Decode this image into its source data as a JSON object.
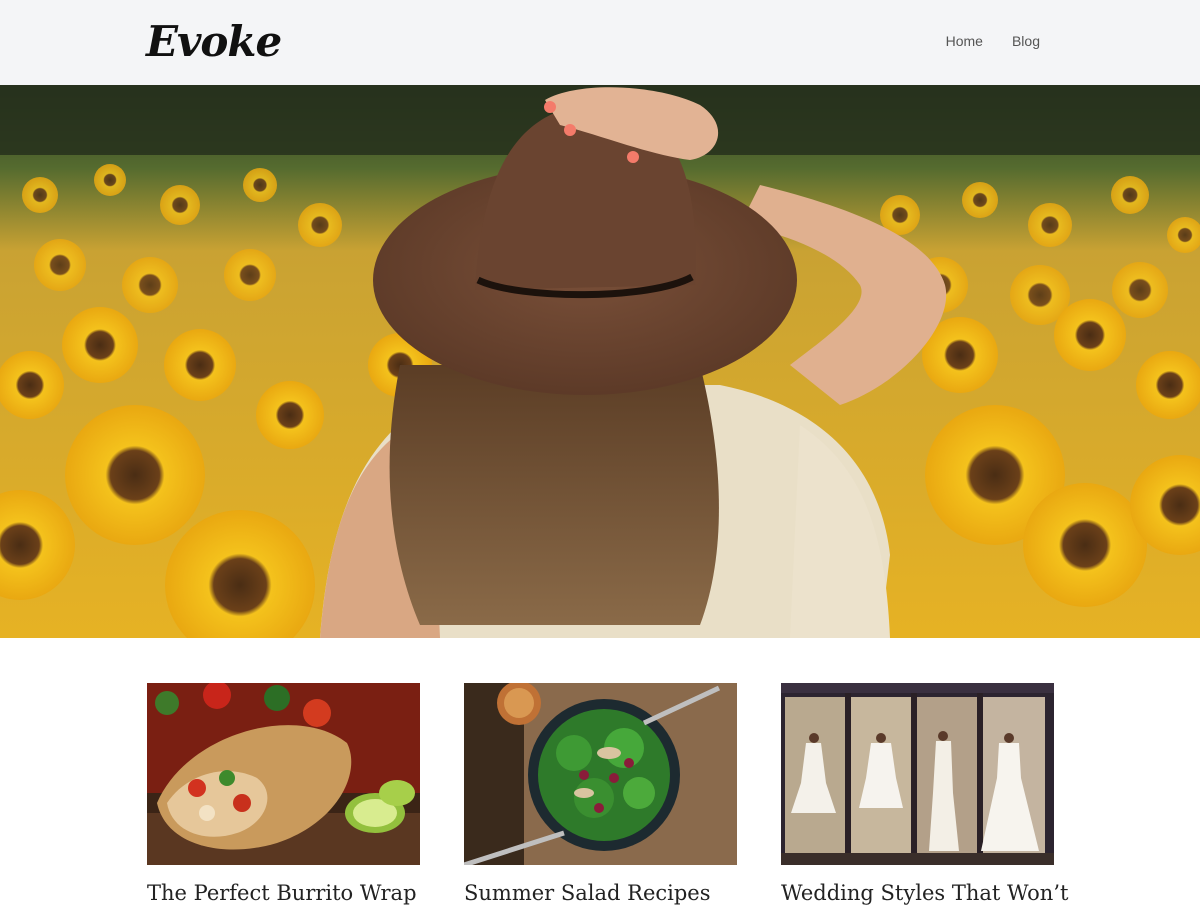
{
  "site": {
    "logo": "Evoke"
  },
  "nav": {
    "items": [
      {
        "label": "Home"
      },
      {
        "label": "Blog"
      }
    ]
  },
  "hero": {
    "image": "woman-in-sunflower-field"
  },
  "posts": [
    {
      "title": "The Perfect Burrito Wrap",
      "image": "burrito-photo"
    },
    {
      "title": "Summer Salad Recipes",
      "image": "salad-bowl-photo"
    },
    {
      "title": "Wedding Styles That Won’t",
      "image": "wedding-dress-window-photo"
    }
  ],
  "colors": {
    "header_bg": "#f4f5f7",
    "sunflower": "#f2b81a",
    "hat": "#6e4a35"
  }
}
